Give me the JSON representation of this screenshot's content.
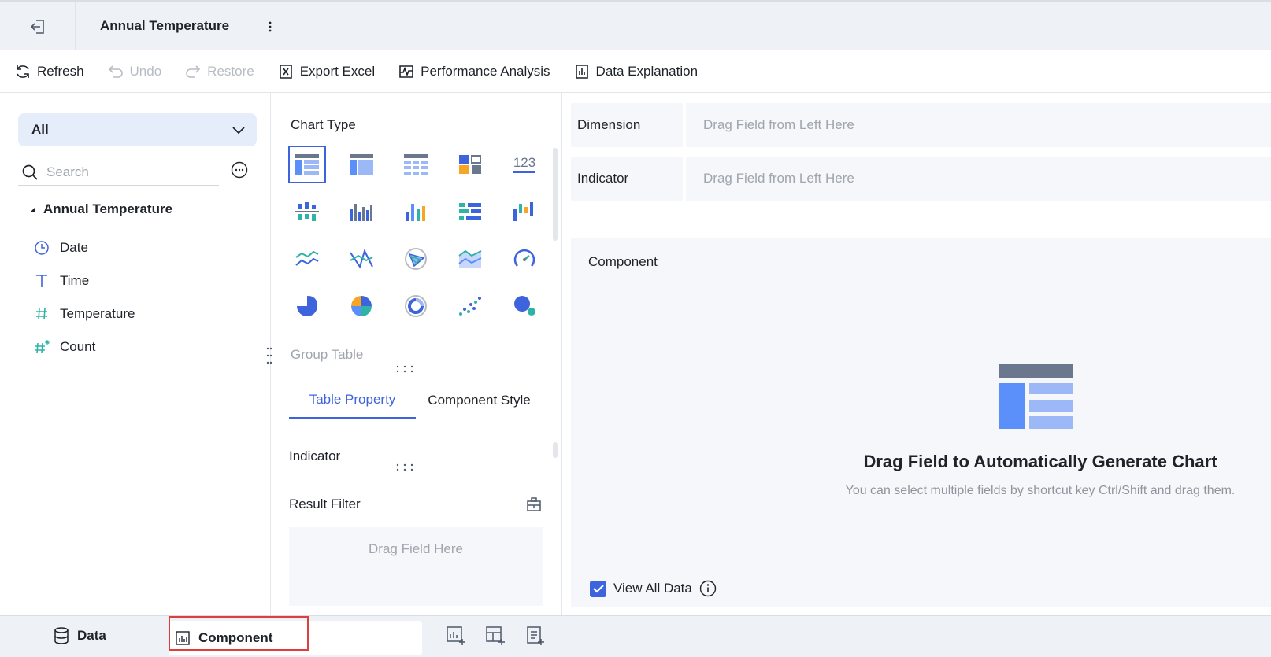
{
  "header": {
    "title": "Annual Temperature"
  },
  "toolbar": {
    "refresh": "Refresh",
    "undo": "Undo",
    "restore": "Restore",
    "export_excel": "Export Excel",
    "performance_analysis": "Performance Analysis",
    "data_explanation": "Data Explanation"
  },
  "left_panel": {
    "scope_value": "All",
    "search_placeholder": "Search",
    "dataset_name": "Annual Temperature",
    "fields": [
      {
        "name": "Date",
        "icon": "clock-icon"
      },
      {
        "name": "Time",
        "icon": "text-type-icon"
      },
      {
        "name": "Temperature",
        "icon": "number-type-icon"
      },
      {
        "name": "Count",
        "icon": "calculated-number-icon"
      }
    ]
  },
  "chart_panel": {
    "chart_type_label": "Chart Type",
    "selected_chart": "Group Table",
    "tabs": [
      "Table Property",
      "Component Style"
    ],
    "indicator_label": "Indicator",
    "result_filter_label": "Result Filter",
    "result_filter_drop": "Drag Field Here"
  },
  "analysis": {
    "dimension_label": "Dimension",
    "dimension_drop": "Drag Field from Left Here",
    "indicator_label": "Indicator",
    "indicator_drop": "Drag Field from Left Here"
  },
  "canvas": {
    "title": "Component",
    "empty_title": "Drag Field to Automatically Generate Chart",
    "empty_subtitle": "You can select multiple fields by shortcut key Ctrl/Shift and drag them.",
    "view_all_data": "View All Data"
  },
  "bottom": {
    "data_tab": "Data",
    "component_tab": "Component"
  },
  "colors": {
    "accent": "#3d63dd",
    "highlight": "#e03e3e"
  }
}
